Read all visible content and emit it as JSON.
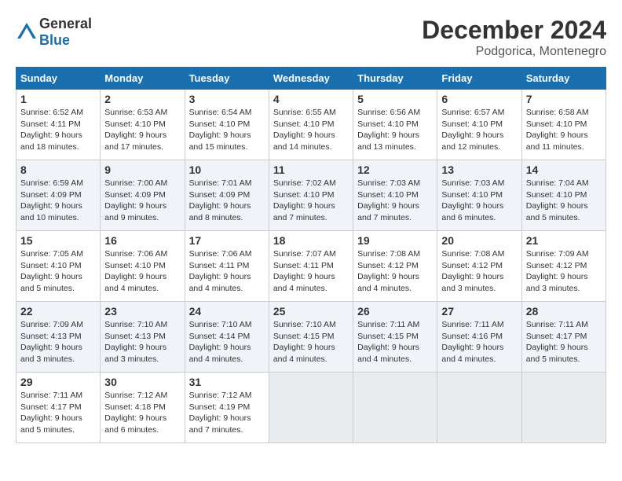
{
  "header": {
    "logo_general": "General",
    "logo_blue": "Blue",
    "month": "December 2024",
    "location": "Podgorica, Montenegro"
  },
  "weekdays": [
    "Sunday",
    "Monday",
    "Tuesday",
    "Wednesday",
    "Thursday",
    "Friday",
    "Saturday"
  ],
  "weeks": [
    [
      {
        "day": "1",
        "sunrise": "Sunrise: 6:52 AM",
        "sunset": "Sunset: 4:11 PM",
        "daylight": "Daylight: 9 hours and 18 minutes."
      },
      {
        "day": "2",
        "sunrise": "Sunrise: 6:53 AM",
        "sunset": "Sunset: 4:10 PM",
        "daylight": "Daylight: 9 hours and 17 minutes."
      },
      {
        "day": "3",
        "sunrise": "Sunrise: 6:54 AM",
        "sunset": "Sunset: 4:10 PM",
        "daylight": "Daylight: 9 hours and 15 minutes."
      },
      {
        "day": "4",
        "sunrise": "Sunrise: 6:55 AM",
        "sunset": "Sunset: 4:10 PM",
        "daylight": "Daylight: 9 hours and 14 minutes."
      },
      {
        "day": "5",
        "sunrise": "Sunrise: 6:56 AM",
        "sunset": "Sunset: 4:10 PM",
        "daylight": "Daylight: 9 hours and 13 minutes."
      },
      {
        "day": "6",
        "sunrise": "Sunrise: 6:57 AM",
        "sunset": "Sunset: 4:10 PM",
        "daylight": "Daylight: 9 hours and 12 minutes."
      },
      {
        "day": "7",
        "sunrise": "Sunrise: 6:58 AM",
        "sunset": "Sunset: 4:10 PM",
        "daylight": "Daylight: 9 hours and 11 minutes."
      }
    ],
    [
      {
        "day": "8",
        "sunrise": "Sunrise: 6:59 AM",
        "sunset": "Sunset: 4:09 PM",
        "daylight": "Daylight: 9 hours and 10 minutes."
      },
      {
        "day": "9",
        "sunrise": "Sunrise: 7:00 AM",
        "sunset": "Sunset: 4:09 PM",
        "daylight": "Daylight: 9 hours and 9 minutes."
      },
      {
        "day": "10",
        "sunrise": "Sunrise: 7:01 AM",
        "sunset": "Sunset: 4:09 PM",
        "daylight": "Daylight: 9 hours and 8 minutes."
      },
      {
        "day": "11",
        "sunrise": "Sunrise: 7:02 AM",
        "sunset": "Sunset: 4:10 PM",
        "daylight": "Daylight: 9 hours and 7 minutes."
      },
      {
        "day": "12",
        "sunrise": "Sunrise: 7:03 AM",
        "sunset": "Sunset: 4:10 PM",
        "daylight": "Daylight: 9 hours and 7 minutes."
      },
      {
        "day": "13",
        "sunrise": "Sunrise: 7:03 AM",
        "sunset": "Sunset: 4:10 PM",
        "daylight": "Daylight: 9 hours and 6 minutes."
      },
      {
        "day": "14",
        "sunrise": "Sunrise: 7:04 AM",
        "sunset": "Sunset: 4:10 PM",
        "daylight": "Daylight: 9 hours and 5 minutes."
      }
    ],
    [
      {
        "day": "15",
        "sunrise": "Sunrise: 7:05 AM",
        "sunset": "Sunset: 4:10 PM",
        "daylight": "Daylight: 9 hours and 5 minutes."
      },
      {
        "day": "16",
        "sunrise": "Sunrise: 7:06 AM",
        "sunset": "Sunset: 4:10 PM",
        "daylight": "Daylight: 9 hours and 4 minutes."
      },
      {
        "day": "17",
        "sunrise": "Sunrise: 7:06 AM",
        "sunset": "Sunset: 4:11 PM",
        "daylight": "Daylight: 9 hours and 4 minutes."
      },
      {
        "day": "18",
        "sunrise": "Sunrise: 7:07 AM",
        "sunset": "Sunset: 4:11 PM",
        "daylight": "Daylight: 9 hours and 4 minutes."
      },
      {
        "day": "19",
        "sunrise": "Sunrise: 7:08 AM",
        "sunset": "Sunset: 4:12 PM",
        "daylight": "Daylight: 9 hours and 4 minutes."
      },
      {
        "day": "20",
        "sunrise": "Sunrise: 7:08 AM",
        "sunset": "Sunset: 4:12 PM",
        "daylight": "Daylight: 9 hours and 3 minutes."
      },
      {
        "day": "21",
        "sunrise": "Sunrise: 7:09 AM",
        "sunset": "Sunset: 4:12 PM",
        "daylight": "Daylight: 9 hours and 3 minutes."
      }
    ],
    [
      {
        "day": "22",
        "sunrise": "Sunrise: 7:09 AM",
        "sunset": "Sunset: 4:13 PM",
        "daylight": "Daylight: 9 hours and 3 minutes."
      },
      {
        "day": "23",
        "sunrise": "Sunrise: 7:10 AM",
        "sunset": "Sunset: 4:13 PM",
        "daylight": "Daylight: 9 hours and 3 minutes."
      },
      {
        "day": "24",
        "sunrise": "Sunrise: 7:10 AM",
        "sunset": "Sunset: 4:14 PM",
        "daylight": "Daylight: 9 hours and 4 minutes."
      },
      {
        "day": "25",
        "sunrise": "Sunrise: 7:10 AM",
        "sunset": "Sunset: 4:15 PM",
        "daylight": "Daylight: 9 hours and 4 minutes."
      },
      {
        "day": "26",
        "sunrise": "Sunrise: 7:11 AM",
        "sunset": "Sunset: 4:15 PM",
        "daylight": "Daylight: 9 hours and 4 minutes."
      },
      {
        "day": "27",
        "sunrise": "Sunrise: 7:11 AM",
        "sunset": "Sunset: 4:16 PM",
        "daylight": "Daylight: 9 hours and 4 minutes."
      },
      {
        "day": "28",
        "sunrise": "Sunrise: 7:11 AM",
        "sunset": "Sunset: 4:17 PM",
        "daylight": "Daylight: 9 hours and 5 minutes."
      }
    ],
    [
      {
        "day": "29",
        "sunrise": "Sunrise: 7:11 AM",
        "sunset": "Sunset: 4:17 PM",
        "daylight": "Daylight: 9 hours and 5 minutes."
      },
      {
        "day": "30",
        "sunrise": "Sunrise: 7:12 AM",
        "sunset": "Sunset: 4:18 PM",
        "daylight": "Daylight: 9 hours and 6 minutes."
      },
      {
        "day": "31",
        "sunrise": "Sunrise: 7:12 AM",
        "sunset": "Sunset: 4:19 PM",
        "daylight": "Daylight: 9 hours and 7 minutes."
      },
      null,
      null,
      null,
      null
    ]
  ]
}
